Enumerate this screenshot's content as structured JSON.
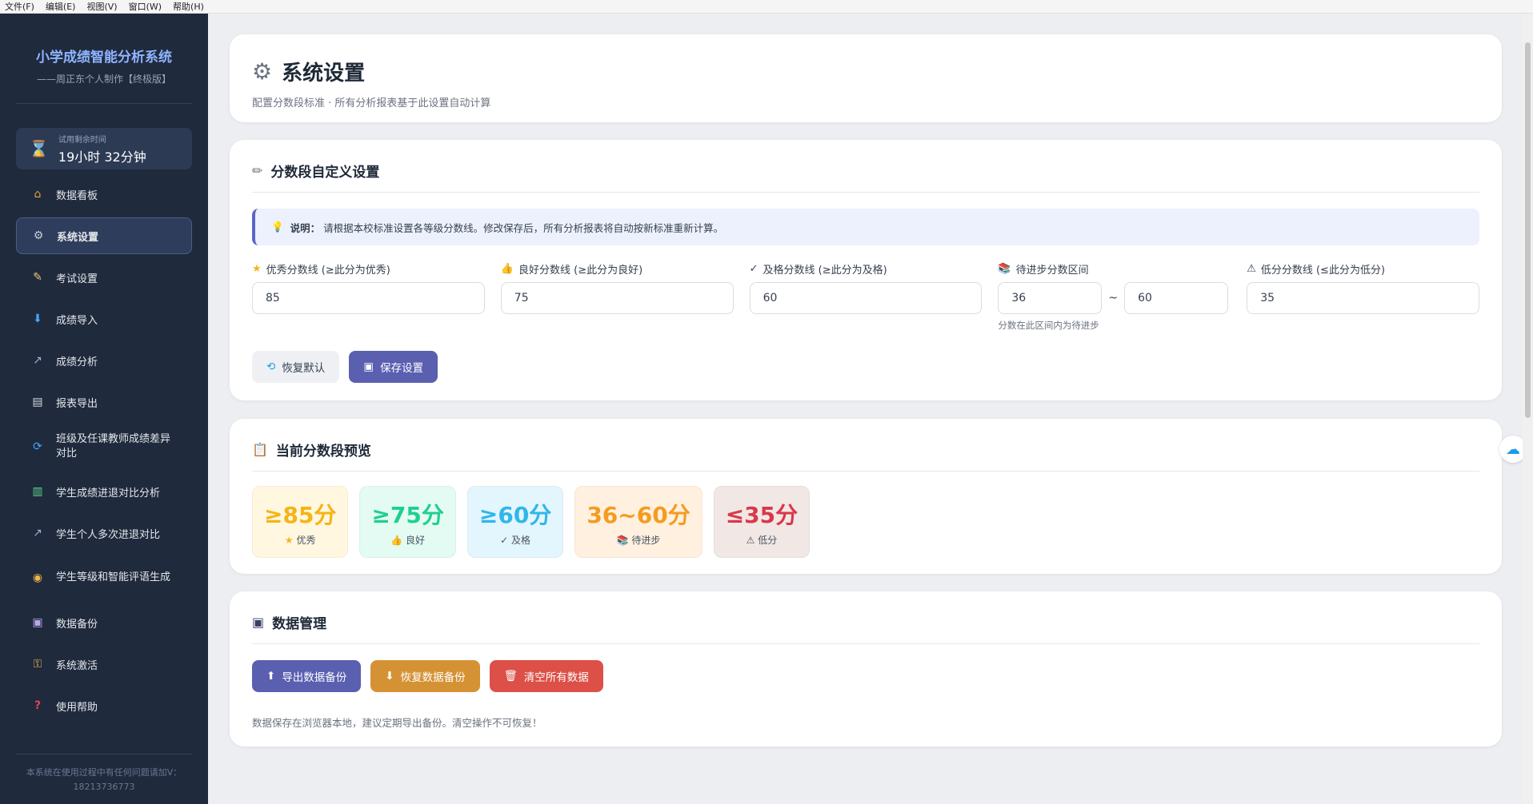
{
  "menubar": {
    "items": [
      "文件(F)",
      "编辑(E)",
      "视图(V)",
      "窗口(W)",
      "帮助(H)"
    ]
  },
  "sidebar": {
    "title": "小学成绩智能分析系统",
    "subtitle": "——周正东个人制作【终极版】",
    "trial": {
      "label": "试用剩余时间",
      "value": "19小时 32分钟"
    },
    "items": [
      {
        "label": "数据看板",
        "icon": "house"
      },
      {
        "label": "系统设置",
        "icon": "gear"
      },
      {
        "label": "考试设置",
        "icon": "memo"
      },
      {
        "label": "成绩导入",
        "icon": "inbox-tray"
      },
      {
        "label": "成绩分析",
        "icon": "chart-up"
      },
      {
        "label": "报表导出",
        "icon": "page"
      },
      {
        "label": "班级及任课教师成绩差异对比",
        "icon": "arrows-cycle"
      },
      {
        "label": "学生成绩进退对比分析",
        "icon": "bar-chart"
      },
      {
        "label": "学生个人多次进退对比",
        "icon": "chart-up"
      },
      {
        "label": "学生等级和智能评语生成",
        "icon": "medal"
      },
      {
        "label": "数据备份",
        "icon": "floppy-disk"
      },
      {
        "label": "系统激活",
        "icon": "key"
      },
      {
        "label": "使用帮助",
        "icon": "question"
      }
    ],
    "footer": "本系统在使用过程中有任何问题请加V：18213736773"
  },
  "header": {
    "title": "系统设置",
    "subtitle": "配置分数段标准 · 所有分析报表基于此设置自动计算"
  },
  "settings": {
    "title": "分数段自定义设置",
    "notice_bold": "说明：",
    "notice_text": "请根据本校标准设置各等级分数线。修改保存后，所有分析报表将自动按新标准重新计算。",
    "fields": {
      "excellent": {
        "label": "优秀分数线 (≥此分为优秀)",
        "value": "85"
      },
      "good": {
        "label": "良好分数线 (≥此分为良好)",
        "value": "75"
      },
      "pass": {
        "label": "及格分数线 (≥此分为及格)",
        "value": "60"
      },
      "progress": {
        "label": "待进步分数区间",
        "min": "36",
        "max": "60",
        "separator": "~",
        "hint": "分数在此区间内为待进步"
      },
      "low": {
        "label": "低分分数线 (≤此分为低分)",
        "value": "35"
      }
    },
    "reset_label": "恢复默认",
    "save_label": "保存设置"
  },
  "preview": {
    "title": "当前分数段预览",
    "tiles": [
      {
        "value": "≥85分",
        "label": "优秀",
        "color": "#f5b416",
        "bg": "#fff7df"
      },
      {
        "value": "≥75分",
        "label": "良好",
        "color": "#1fcf8f",
        "bg": "#e3fbf2"
      },
      {
        "value": "≥60分",
        "label": "及格",
        "color": "#2fb7e9",
        "bg": "#e3f5fd"
      },
      {
        "value": "36~60分",
        "label": "待进步",
        "color": "#f39c1f",
        "bg": "#fff0df"
      },
      {
        "value": "≤35分",
        "label": "低分",
        "color": "#d8384a",
        "bg": "#f1e7e4"
      }
    ]
  },
  "data_mgmt": {
    "title": "数据管理",
    "export_label": "导出数据备份",
    "restore_label": "恢复数据备份",
    "clear_label": "清空所有数据",
    "note": "数据保存在浏览器本地，建议定期导出备份。清空操作不可恢复！"
  }
}
